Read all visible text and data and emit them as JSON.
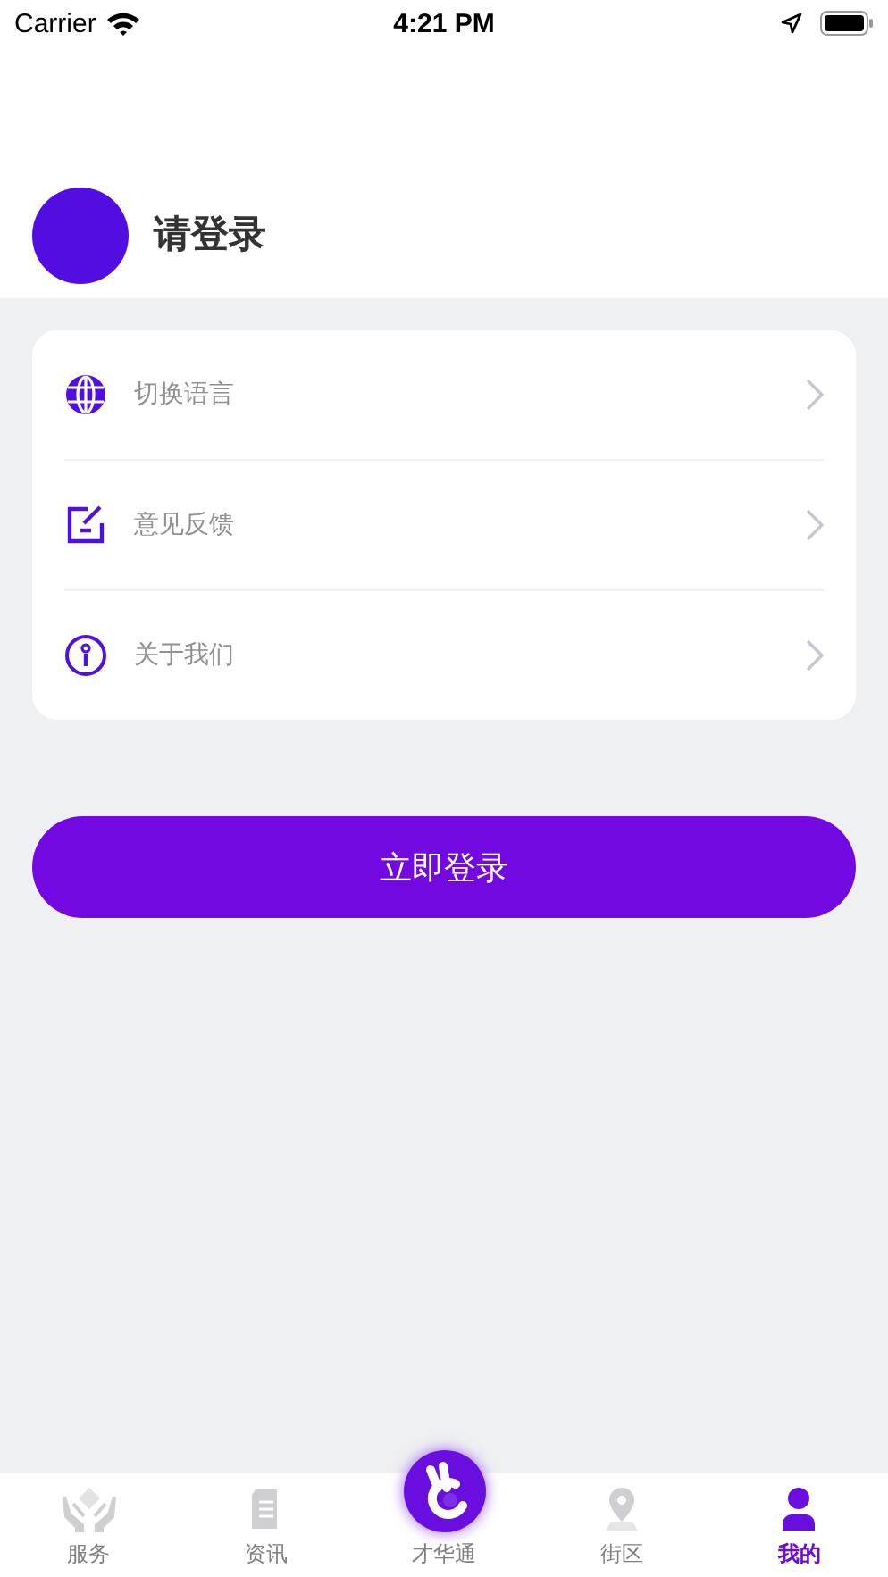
{
  "status_bar": {
    "carrier": "Carrier",
    "time": "4:21 PM"
  },
  "profile": {
    "name": "请登录"
  },
  "menu": [
    {
      "kind": "globe",
      "label": "切换语言"
    },
    {
      "kind": "edit",
      "label": "意见反馈"
    },
    {
      "kind": "info",
      "label": "关于我们"
    }
  ],
  "login_button": "立即登录",
  "tab_bar": [
    {
      "kind": "hands",
      "label": "服务",
      "selected": false
    },
    {
      "kind": "document",
      "label": "资讯",
      "selected": false
    },
    {
      "kind": "center",
      "label": "才华通",
      "selected": false
    },
    {
      "kind": "pin",
      "label": "街区",
      "selected": false
    },
    {
      "kind": "person",
      "label": "我的",
      "selected": true
    }
  ]
}
